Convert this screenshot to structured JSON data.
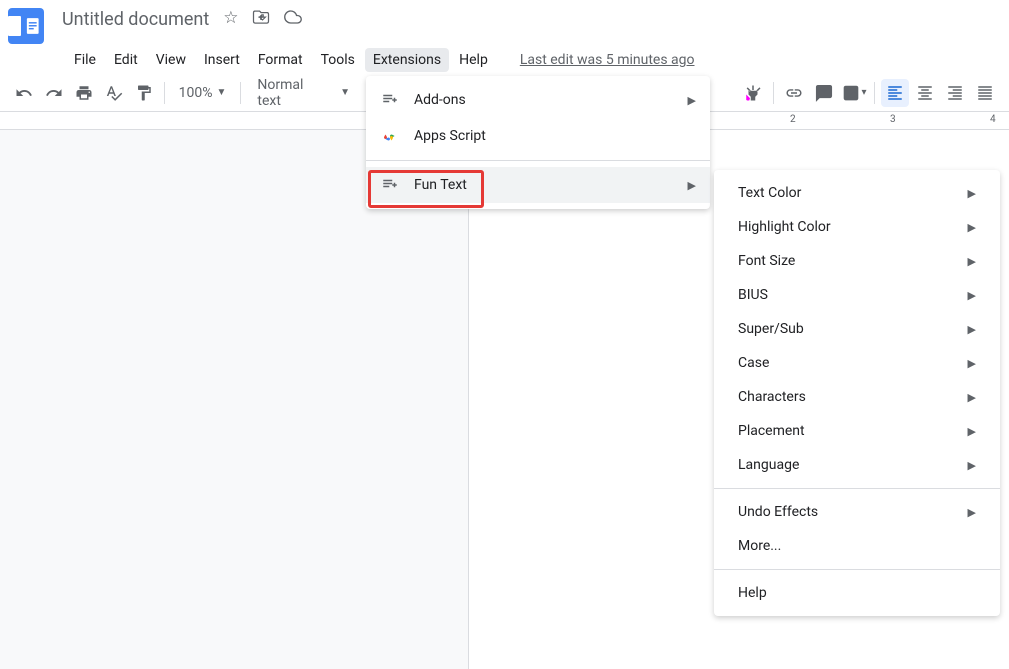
{
  "header": {
    "title": "Untitled document",
    "star_icon": "star-outline",
    "move_icon": "folder-move",
    "cloud_icon": "cloud-done"
  },
  "menu": {
    "items": [
      {
        "label": "File"
      },
      {
        "label": "Edit"
      },
      {
        "label": "View"
      },
      {
        "label": "Insert"
      },
      {
        "label": "Format"
      },
      {
        "label": "Tools"
      },
      {
        "label": "Extensions"
      },
      {
        "label": "Help"
      }
    ],
    "last_edit": "Last edit was 5 minutes ago"
  },
  "toolbar": {
    "zoom": "100%",
    "style": "Normal text"
  },
  "ruler": {
    "marks": [
      "2",
      "3",
      "4"
    ]
  },
  "ext_menu": {
    "addons": "Add-ons",
    "apps_script": "Apps Script",
    "fun_text": "Fun Text"
  },
  "submenu": {
    "items_group1": [
      {
        "label": "Text Color",
        "arrow": true
      },
      {
        "label": "Highlight Color",
        "arrow": true
      },
      {
        "label": "Font Size",
        "arrow": true
      },
      {
        "label": "BIUS",
        "arrow": true
      },
      {
        "label": "Super/Sub",
        "arrow": true
      },
      {
        "label": "Case",
        "arrow": true
      },
      {
        "label": "Characters",
        "arrow": true
      },
      {
        "label": "Placement",
        "arrow": true
      },
      {
        "label": "Language",
        "arrow": true
      }
    ],
    "items_group2": [
      {
        "label": "Undo Effects",
        "arrow": true
      },
      {
        "label": "More...",
        "arrow": false
      }
    ],
    "items_group3": [
      {
        "label": "Help",
        "arrow": false
      }
    ]
  }
}
